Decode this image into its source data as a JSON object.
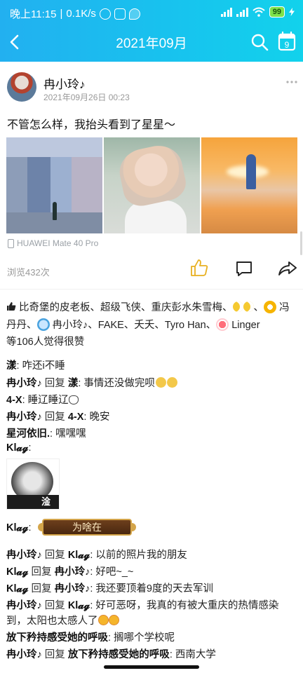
{
  "status_bar": {
    "time": "晚上11:15",
    "net_speed": "0.1K/s",
    "battery": "99"
  },
  "header": {
    "title": "2021年09月",
    "calendar_day": "9",
    "accent_color": "#1ab8ef"
  },
  "post": {
    "author": "冉小玲♪",
    "time": "2021年09月26日 00:23",
    "text": "不管怎么样，我抬头看到了星星～",
    "device": "HUAWEI Mate 40 Pro",
    "views": "浏览432次",
    "photos": [
      "photo-1",
      "photo-2",
      "photo-3"
    ]
  },
  "likes": {
    "names_a": "比奇堡的皮老板、超级飞侠、重庆彭水朱雪梅、",
    "sep1": "、",
    "name_b": "冯丹丹、",
    "name_c": "冉小玲♪、FAKE、夭夭、Tyro Han、",
    "name_d": "Linger",
    "summary": "等106人觉得很赞"
  },
  "comments": [
    {
      "name": "漾",
      "reply_label": "",
      "reply_to": "",
      "text": ": 咋还i不睡"
    },
    {
      "name": "冉小玲♪",
      "reply_label": " 回复 ",
      "reply_to": "漾",
      "text": ": 事情还没做完呗"
    },
    {
      "name": "4-X",
      "reply_label": "",
      "reply_to": "",
      "text": ": 睡辽睡辽"
    },
    {
      "name": "冉小玲♪",
      "reply_label": " 回复 ",
      "reply_to": "4-X",
      "text": ": 晚安"
    },
    {
      "name": "星河依旧.",
      "reply_label": "",
      "reply_to": "",
      "text": ": 嘿嘿嘿"
    },
    {
      "name": "Kl𝓪𝓰",
      "reply_label": "",
      "reply_to": "",
      "text": ":"
    },
    {
      "name": "Kl𝓪𝓰",
      "reply_label": "",
      "reply_to": "",
      "text": ":"
    },
    {
      "name": "冉小玲♪",
      "reply_label": " 回复 ",
      "reply_to": "Kl𝓪𝓰",
      "text": ": 以前的照片我的朋友"
    },
    {
      "name": "Kl𝓪𝓰",
      "reply_label": " 回复 ",
      "reply_to": "冉小玲♪",
      "text": ": 好吧~_~"
    },
    {
      "name": "Kl𝓪𝓰",
      "reply_label": " 回复 ",
      "reply_to": "冉小玲♪",
      "text": ": 我还要顶着9度的天去军训"
    },
    {
      "name": "冉小玲♪",
      "reply_label": " 回复 ",
      "reply_to": "Kl𝓪𝓰",
      "text": ": 好可恶呀，我真的有被大重庆的热情感染"
    },
    {
      "name": "",
      "reply_label": "",
      "reply_to": "",
      "text": "到，太阳也太感人了"
    },
    {
      "name": "放下矜持感受她的呼吸",
      "reply_label": "",
      "reply_to": "",
      "text": ": 搁哪个学校呢"
    },
    {
      "name": "冉小玲♪",
      "reply_label": " 回复 ",
      "reply_to": "放下矜持感受她的呼吸",
      "text": ": 西南大学"
    }
  ],
  "sticker": {
    "caption": "淦"
  },
  "banner": {
    "text": "为啥在"
  }
}
